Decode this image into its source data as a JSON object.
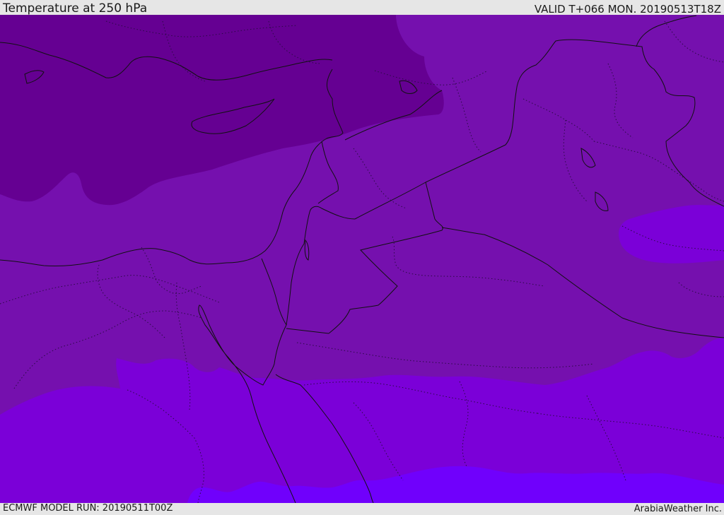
{
  "header": {
    "title": "Temperature at 250 hPa",
    "valid": "VALID T+066 MON. 20190513T18Z"
  },
  "footer": {
    "model_run": "ECMWF MODEL RUN: 20190511T00Z",
    "credit": "ArabiaWeather Inc."
  },
  "colors": {
    "band_coldest_north": "#650092",
    "band_mid": "#7510ae",
    "band_warm": "#7b00d8",
    "band_warmest": "#7000fc",
    "border_line": "#111111",
    "dotted_line": "#2a0b44",
    "frame": "#e6e6e6"
  }
}
